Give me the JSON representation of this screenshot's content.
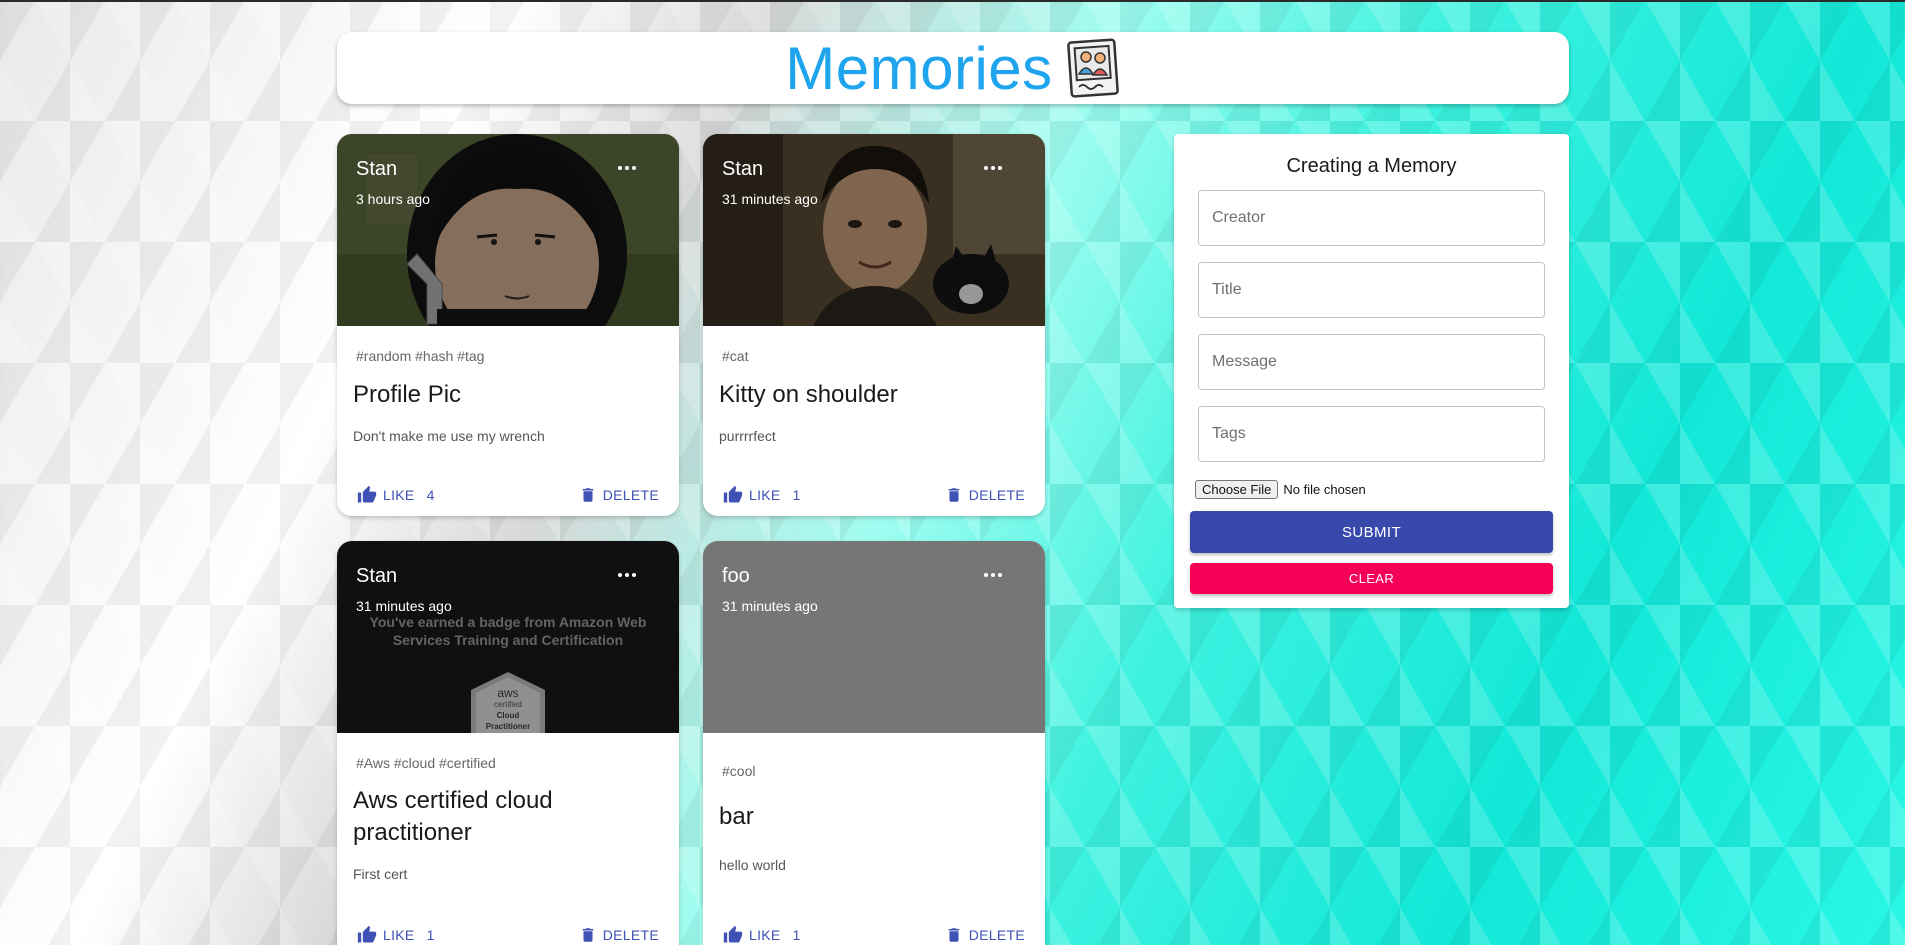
{
  "app": {
    "title": "Memories",
    "logo_icon": "memories-photo-icon"
  },
  "colors": {
    "accent": "#1ea5ee",
    "primary": "#3f51b5",
    "submit": "#3949ab",
    "secondary": "#f50057"
  },
  "posts": [
    {
      "creator": "Stan",
      "time": "3 hours ago",
      "tags": "#random #hash #tag",
      "title": "Profile Pic",
      "message": "Don't make me use my wrench",
      "like_label": "LIKE",
      "like_count": "4",
      "delete_label": "DELETE",
      "image": "cartoon-portrait"
    },
    {
      "creator": "Stan",
      "time": "31 minutes ago",
      "tags": "#cat",
      "title": "Kitty on shoulder",
      "message": "purrrrfect",
      "like_label": "LIKE",
      "like_count": "1",
      "delete_label": "DELETE",
      "image": "selfie-with-cat"
    },
    {
      "creator": "Stan",
      "time": "31 minutes ago",
      "tags": "#Aws #cloud #certified",
      "title": "Aws certified cloud practitioner",
      "message": "First cert",
      "like_label": "LIKE",
      "like_count": "1",
      "delete_label": "DELETE",
      "image": "aws-badge",
      "image_text": "You've earned a badge from Amazon Web Services Training and Certification",
      "badge_line1": "aws",
      "badge_line2": "certified",
      "badge_line3": "Cloud",
      "badge_line4": "Practitioner"
    },
    {
      "creator": "foo",
      "time": "31 minutes ago",
      "tags": "#cool",
      "title": "bar",
      "message": "hello world",
      "like_label": "LIKE",
      "like_count": "1",
      "delete_label": "DELETE",
      "image": "placeholder-gray"
    }
  ],
  "form": {
    "title": "Creating a Memory",
    "creator_placeholder": "Creator",
    "title_placeholder": "Title",
    "message_placeholder": "Message",
    "tags_placeholder": "Tags",
    "file_button": "Choose File",
    "file_status": "No file chosen",
    "submit_label": "SUBMIT",
    "clear_label": "CLEAR"
  }
}
